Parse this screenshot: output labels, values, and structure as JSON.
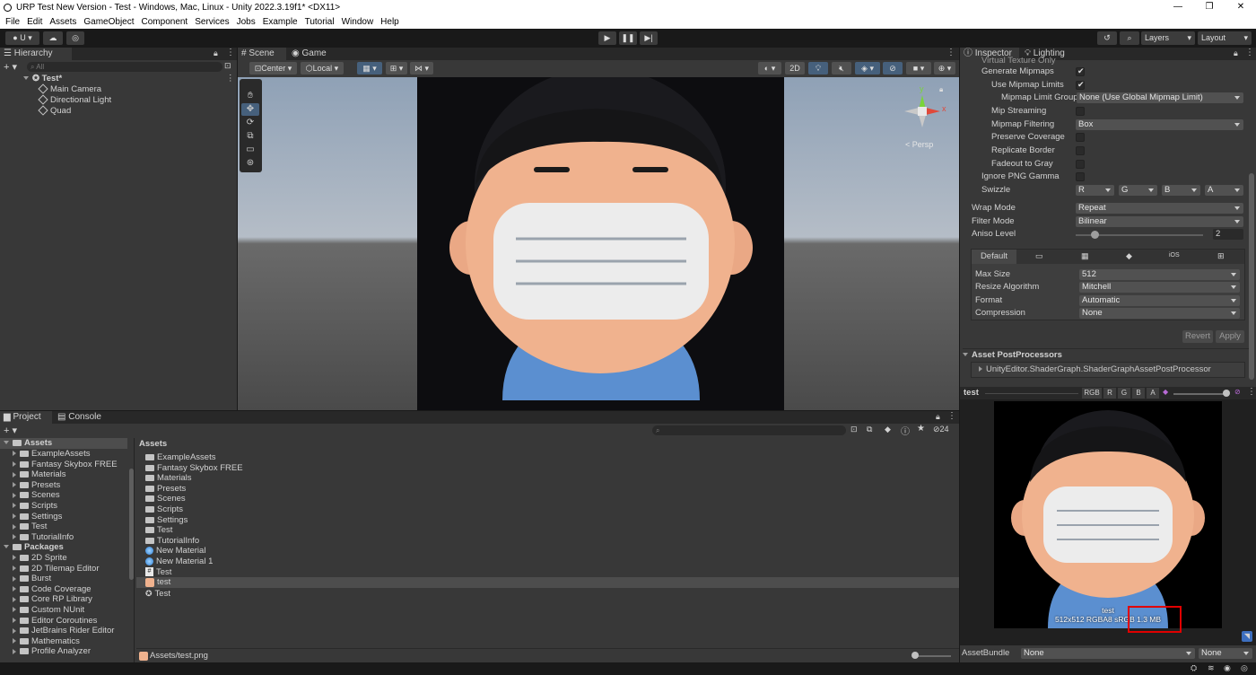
{
  "window": {
    "title": "URP Test New Version - Test - Windows, Mac, Linux - Unity 2022.3.19f1* <DX11>"
  },
  "menu": [
    "File",
    "Edit",
    "Assets",
    "GameObject",
    "Component",
    "Services",
    "Jobs",
    "Example",
    "Tutorial",
    "Window",
    "Help"
  ],
  "toolbar": {
    "account_label": "U",
    "layers_label": "Layers",
    "layout_label": "Layout"
  },
  "hierarchy": {
    "tab_label": "Hierarchy",
    "search_placeholder": "All",
    "scene_name": "Test*",
    "items": [
      "Main Camera",
      "Directional Light",
      "Quad"
    ]
  },
  "scene_view": {
    "tabs": [
      "Scene",
      "Game"
    ],
    "pivot_label": "Center",
    "space_label": "Local",
    "mode_2d_label": "2D",
    "persp_label": "< Persp",
    "gizmo_y": "y",
    "gizmo_x": "x"
  },
  "inspector": {
    "tabs": [
      "Inspector",
      "Lighting"
    ],
    "cut_label": "Virtual Texture Only",
    "rows": {
      "generate_mipmaps": "Generate Mipmaps",
      "use_mipmap_limits": "Use Mipmap Limits",
      "mipmap_limit_group": "Mipmap Limit Group",
      "mipmap_limit_group_value": "None (Use Global Mipmap Limit)",
      "mip_streaming": "Mip Streaming",
      "mipmap_filtering": "Mipmap Filtering",
      "mipmap_filtering_value": "Box",
      "preserve_coverage": "Preserve Coverage",
      "replicate_border": "Replicate Border",
      "fadeout_to_gray": "Fadeout to Gray",
      "ignore_png_gamma": "Ignore PNG Gamma",
      "swizzle": "Swizzle",
      "swizzle_values": [
        "R",
        "G",
        "B",
        "A"
      ],
      "wrap_mode": "Wrap Mode",
      "wrap_mode_value": "Repeat",
      "filter_mode": "Filter Mode",
      "filter_mode_value": "Bilinear",
      "aniso_level": "Aniso Level",
      "aniso_level_value": "2"
    },
    "platform_tabs": {
      "default_label": "Default",
      "ios_label": "iOS"
    },
    "platform": {
      "max_size": "Max Size",
      "max_size_value": "512",
      "resize_algorithm": "Resize Algorithm",
      "resize_algorithm_value": "Mitchell",
      "format": "Format",
      "format_value": "Automatic",
      "compression": "Compression",
      "compression_value": "None"
    },
    "revert_label": "Revert",
    "apply_label": "Apply",
    "postprocessors_title": "Asset PostProcessors",
    "postprocessor_item": "UnityEditor.ShaderGraph.ShaderGraphAssetPostProcessor"
  },
  "preview": {
    "title": "test",
    "channels": [
      "RGB",
      "R",
      "G",
      "B",
      "A"
    ],
    "caption_name": "test",
    "caption_info": "512x512  RGBA8 sRGB  1.3 MB",
    "assetbundle_label": "AssetBundle",
    "assetbundle_value": "None",
    "assetbundle_variant": "None",
    "highlight_color": "#e00000"
  },
  "project": {
    "tabs": [
      "Project",
      "Console"
    ],
    "badge_count": "24",
    "tree_assets_label": "Assets",
    "tree_assets": [
      "ExampleAssets",
      "Fantasy Skybox FREE",
      "Materials",
      "Presets",
      "Scenes",
      "Scripts",
      "Settings",
      "Test",
      "TutorialInfo"
    ],
    "tree_packages_label": "Packages",
    "tree_packages": [
      "2D Sprite",
      "2D Tilemap Editor",
      "Burst",
      "Code Coverage",
      "Core RP Library",
      "Custom NUnit",
      "Editor Coroutines",
      "JetBrains Rider Editor",
      "Mathematics",
      "Profile Analyzer"
    ],
    "breadcrumb": "Assets",
    "files": [
      {
        "name": "ExampleAssets",
        "icon": "folder-icon"
      },
      {
        "name": "Fantasy Skybox FREE",
        "icon": "folder-icon"
      },
      {
        "name": "Materials",
        "icon": "folder-icon"
      },
      {
        "name": "Presets",
        "icon": "folder-icon"
      },
      {
        "name": "Scenes",
        "icon": "folder-icon"
      },
      {
        "name": "Scripts",
        "icon": "folder-icon"
      },
      {
        "name": "Settings",
        "icon": "folder-icon"
      },
      {
        "name": "Test",
        "icon": "folder-icon"
      },
      {
        "name": "TutorialInfo",
        "icon": "folder-icon"
      },
      {
        "name": "New Material",
        "icon": "material-icon"
      },
      {
        "name": "New Material 1",
        "icon": "material-icon"
      },
      {
        "name": "Test",
        "icon": "script-icon"
      },
      {
        "name": "test",
        "icon": "texture-icon"
      },
      {
        "name": "Test",
        "icon": "scene-icon"
      }
    ],
    "status_path": "Assets/test.png"
  }
}
